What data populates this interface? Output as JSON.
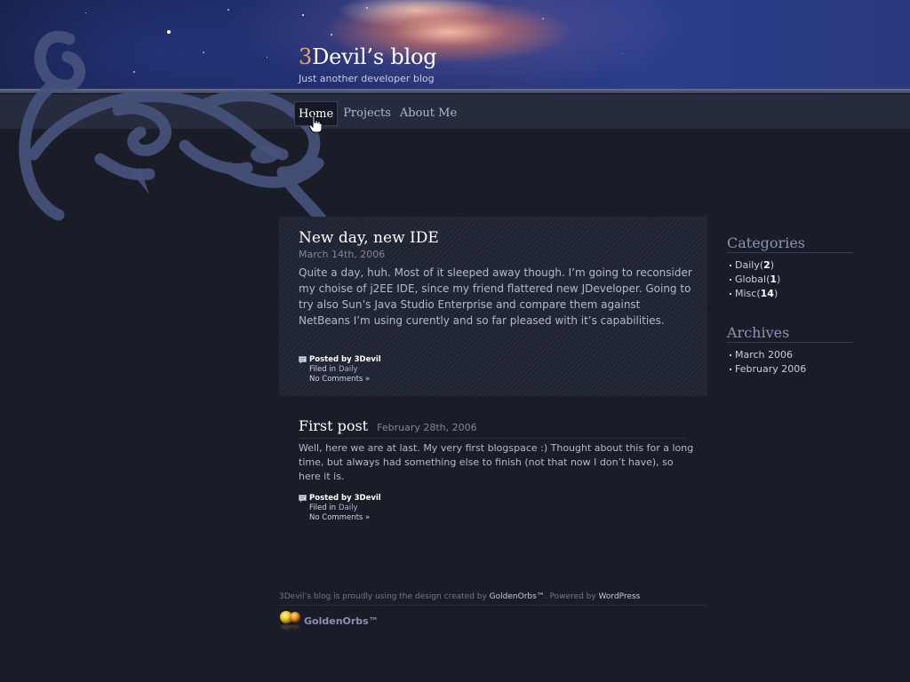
{
  "blog": {
    "title_first_char": "3",
    "title_rest": "Devil’s blog",
    "tagline": "Just another developer blog"
  },
  "nav": {
    "items": [
      "Home",
      "Projects",
      "About Me"
    ],
    "active": "Home"
  },
  "posts": [
    {
      "title": "New day, new IDE",
      "date": "March 14th, 2006",
      "body": "Quite a day, huh. Most of it sleeped away though. I’m going to reconsider my choise of j2EE IDE, since my friend flattered new JDeveloper. Going to try also Sun’s Java Studio Enterprise and compare them against NetBeans I’m using curently and so far pleased with it’s capabilities.",
      "posted_by_label": "Posted by",
      "author": "3Devil",
      "filed_in_label": "Filed in",
      "category": "Daily",
      "comments": "No Comments »"
    },
    {
      "title": "First post",
      "date": "February 28th, 2006",
      "body": "Well, here we are at last. My very first blogspace :) Thought about this for a long time, but always had something else to finish (not that now I don’t have), so here it is.",
      "posted_by_label": "Posted by",
      "author": "3Devil",
      "filed_in_label": "Filed in",
      "category": "Daily",
      "comments": "No Comments »"
    }
  ],
  "sidebar": {
    "categories_heading": "Categories",
    "categories": [
      {
        "name": "Daily",
        "open": " (",
        "count": "2",
        "close": ")"
      },
      {
        "name": "Global",
        "open": " (",
        "count": "1",
        "close": ")"
      },
      {
        "name": "Misc",
        "open": " (",
        "count": "14",
        "close": ")"
      }
    ],
    "archives_heading": "Archives",
    "archives": [
      "March 2006",
      "February 2006"
    ]
  },
  "footer": {
    "text_a": "3Devil’s blog is proudly using the design created by ",
    "link_a": "GoldenOrbs™",
    "text_b": ". Powered by ",
    "link_b": "WordPress",
    "logo_text": "GoldenOrbs™"
  },
  "colors": {
    "background": "#1a1d28",
    "accent_title_char": "#e8a868",
    "link": "#aab3d0"
  }
}
